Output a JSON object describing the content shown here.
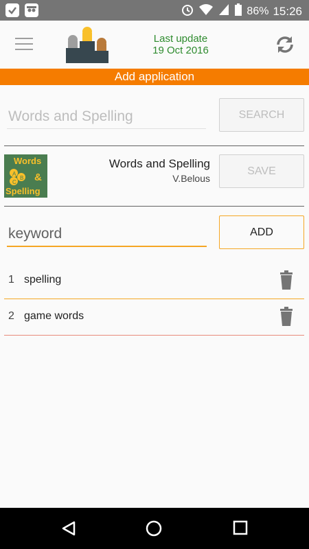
{
  "status_bar": {
    "battery": "86%",
    "time": "15:26"
  },
  "header": {
    "update_label": "Last update",
    "update_date": "19 Oct 2016"
  },
  "banner": {
    "title": "Add application"
  },
  "search": {
    "value": "Words and Spelling",
    "button_label": "SEARCH"
  },
  "app_card": {
    "name": "Words and Spelling",
    "author": "V.Belous",
    "button_label": "SAVE"
  },
  "keyword": {
    "placeholder": "keyword",
    "button_label": "ADD"
  },
  "keywords": [
    {
      "num": "1",
      "label": "spelling"
    },
    {
      "num": "2",
      "label": "game words"
    }
  ],
  "colors": {
    "accent": "#f57c00",
    "update_text": "#2e8b2e",
    "underline": "#f5a623"
  }
}
